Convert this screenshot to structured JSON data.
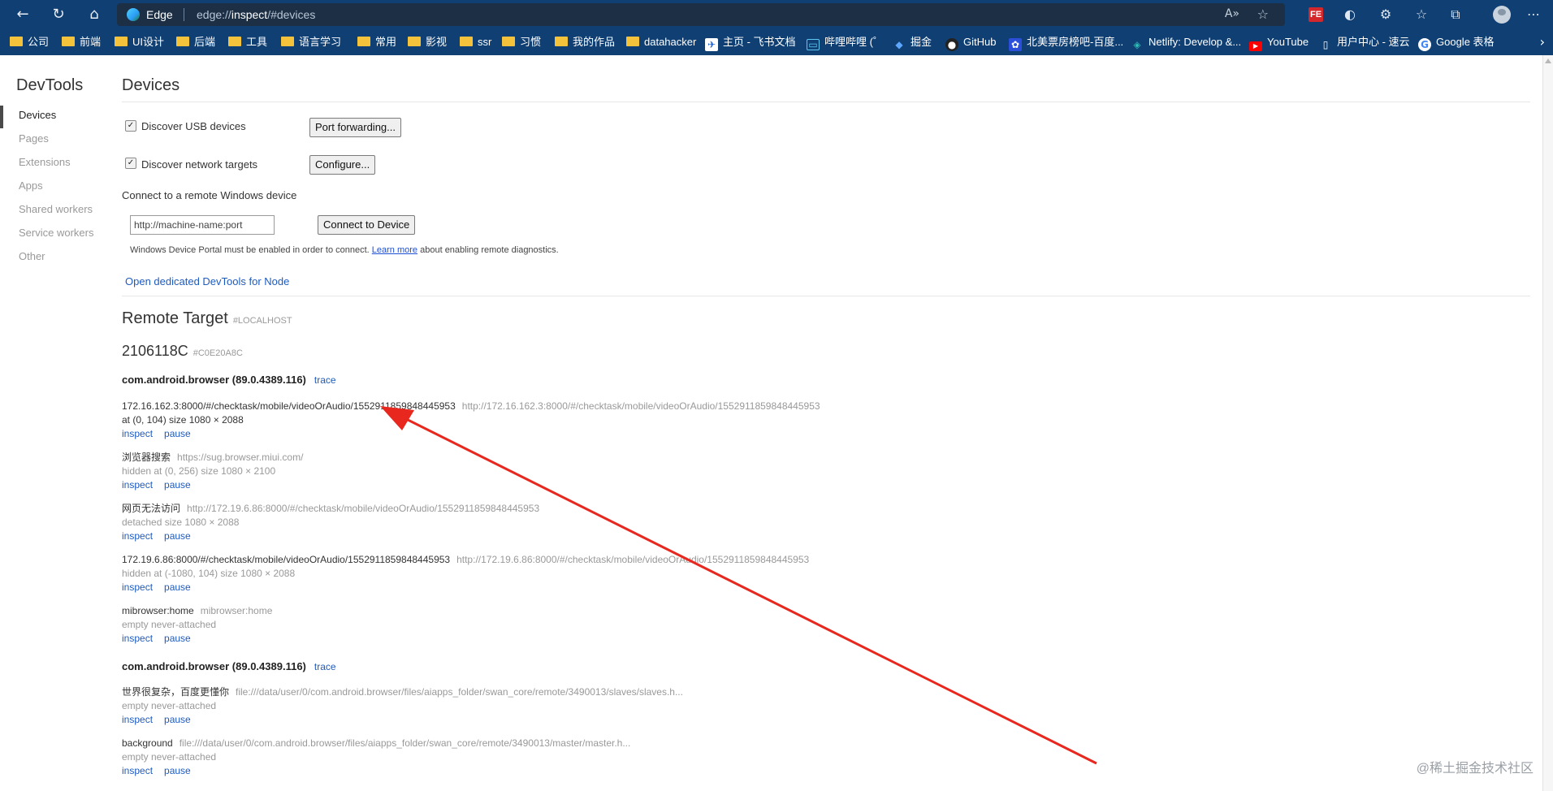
{
  "browser": {
    "site_label": "Edge",
    "url_scheme": "edge://",
    "url_host": "inspect",
    "url_hash": "/#devices",
    "bookmarks": [
      {
        "label": "公司",
        "icon": "folder"
      },
      {
        "label": "前端",
        "icon": "folder"
      },
      {
        "label": "UI设计",
        "icon": "folder"
      },
      {
        "label": "后端",
        "icon": "folder"
      },
      {
        "label": "工具",
        "icon": "folder"
      },
      {
        "label": "语言学习",
        "icon": "folder"
      },
      {
        "label": "常用",
        "icon": "folder"
      },
      {
        "label": "影视",
        "icon": "folder"
      },
      {
        "label": "ssr",
        "icon": "folder"
      },
      {
        "label": "习惯",
        "icon": "folder"
      },
      {
        "label": "我的作品",
        "icon": "folder"
      },
      {
        "label": "datahacker",
        "icon": "folder"
      },
      {
        "label": "主页 - 飞书文档",
        "icon": "feishu-icon"
      },
      {
        "label": "哔哩哔哩 (゜",
        "icon": "bilibili-icon"
      },
      {
        "label": "掘金",
        "icon": "juejin-icon"
      },
      {
        "label": "GitHub",
        "icon": "github-icon"
      },
      {
        "label": "北美票房榜吧-百度...",
        "icon": "baidu-icon"
      },
      {
        "label": "Netlify: Develop &...",
        "icon": "netlify-icon"
      },
      {
        "label": "YouTube",
        "icon": "youtube-icon"
      },
      {
        "label": "用户中心 - 速云",
        "icon": "page-icon"
      },
      {
        "label": "Google 表格",
        "icon": "google-icon"
      }
    ]
  },
  "sidebar": {
    "title": "DevTools",
    "items": [
      {
        "label": "Devices"
      },
      {
        "label": "Pages"
      },
      {
        "label": "Extensions"
      },
      {
        "label": "Apps"
      },
      {
        "label": "Shared workers"
      },
      {
        "label": "Service workers"
      },
      {
        "label": "Other"
      }
    ]
  },
  "devices": {
    "heading": "Devices",
    "discover_usb": {
      "label": "Discover USB devices",
      "checked": true
    },
    "port_forwarding_button": "Port forwarding...",
    "discover_network": {
      "label": "Discover network targets",
      "checked": true
    },
    "configure_button": "Configure...",
    "remote_windows_label": "Connect to a remote Windows device",
    "machine_input_placeholder": "http://machine-name:port",
    "connect_button": "Connect to Device",
    "portal_note_before": "Windows Device Portal must be enabled in order to connect.",
    "portal_note_link": "Learn more",
    "portal_note_after": "about enabling remote diagnostics.",
    "node_link": "Open dedicated DevTools for Node"
  },
  "remote": {
    "heading": "Remote Target",
    "heading_tag": "#LOCALHOST",
    "device_name": "2106118C",
    "device_tag": "#C0E20A8C",
    "packages": [
      {
        "name": "com.android.browser (89.0.4389.116)",
        "trace": "trace",
        "targets": [
          {
            "title": "172.16.162.3:8000/#/checktask/mobile/videoOrAudio/1552911859848445953",
            "url": "http://172.16.162.3:8000/#/checktask/mobile/videoOrAudio/1552911859848445953",
            "info": "at (0, 104)  size 1080 × 2088",
            "info_dark": true,
            "actions": [
              "inspect",
              "pause"
            ]
          },
          {
            "title": "浏览器搜索",
            "url": "https://sug.browser.miui.com/",
            "info": "hidden  at (0, 256)  size 1080 × 2100",
            "info_dark": false,
            "actions": [
              "inspect",
              "pause"
            ]
          },
          {
            "title": "网页无法访问",
            "url": "http://172.19.6.86:8000/#/checktask/mobile/videoOrAudio/1552911859848445953",
            "info": "detached  size 1080 × 2088",
            "info_dark": false,
            "actions": [
              "inspect",
              "pause"
            ]
          },
          {
            "title": "172.19.6.86:8000/#/checktask/mobile/videoOrAudio/1552911859848445953",
            "url": "http://172.19.6.86:8000/#/checktask/mobile/videoOrAudio/1552911859848445953",
            "info": "hidden  at (-1080, 104)  size 1080 × 2088",
            "info_dark": false,
            "actions": [
              "inspect",
              "pause"
            ]
          },
          {
            "title": "mibrowser:home",
            "url": "mibrowser:home",
            "info": "empty never-attached",
            "info_dark": false,
            "actions": [
              "inspect",
              "pause"
            ]
          }
        ]
      },
      {
        "name": "com.android.browser (89.0.4389.116)",
        "trace": "trace",
        "targets": [
          {
            "title": "世界很复杂，百度更懂你",
            "url": "file:///data/user/0/com.android.browser/files/aiapps_folder/swan_core/remote/3490013/slaves/slaves.h...",
            "info": "empty never-attached",
            "info_dark": false,
            "actions": [
              "inspect",
              "pause"
            ]
          },
          {
            "title": "background",
            "url": "file:///data/user/0/com.android.browser/files/aiapps_folder/swan_core/remote/3490013/master/master.h...",
            "info": "empty never-attached",
            "info_dark": false,
            "actions": [
              "inspect",
              "pause"
            ]
          }
        ]
      }
    ]
  },
  "watermark": "@稀土掘金技术社区",
  "colors": {
    "chrome": "#0f3f73",
    "link": "#1e5bbf",
    "annotation_arrow": "#e8281e"
  }
}
